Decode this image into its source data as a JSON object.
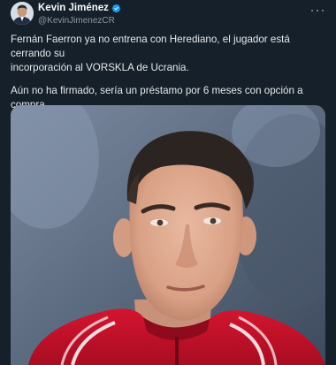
{
  "author": {
    "display_name": "Kevin Jiménez",
    "handle": "@KevinJimenezCR",
    "avatar_icon": "profile-photo",
    "verified_icon": "verified-badge-icon",
    "verified_color": "#1d9bf0"
  },
  "menu": {
    "icon": "more-icon"
  },
  "tweet": {
    "paragraph_1": "Fernán Faerron ya no entrena con Herediano, el jugador está cerrando su\nincorporación al VORSKLA de Ucrania.",
    "paragraph_2": "Aún no ha firmado, sería un préstamo por 6 meses con opción a compra.\nNo está sellado aún, falta formalización."
  },
  "media": {
    "kind": "photo",
    "subject": "player-portrait-photo"
  },
  "colors": {
    "background": "#15202b",
    "text": "#e7e9ea",
    "secondary_text": "#8b98a5",
    "jersey_red": "#c8102e"
  }
}
